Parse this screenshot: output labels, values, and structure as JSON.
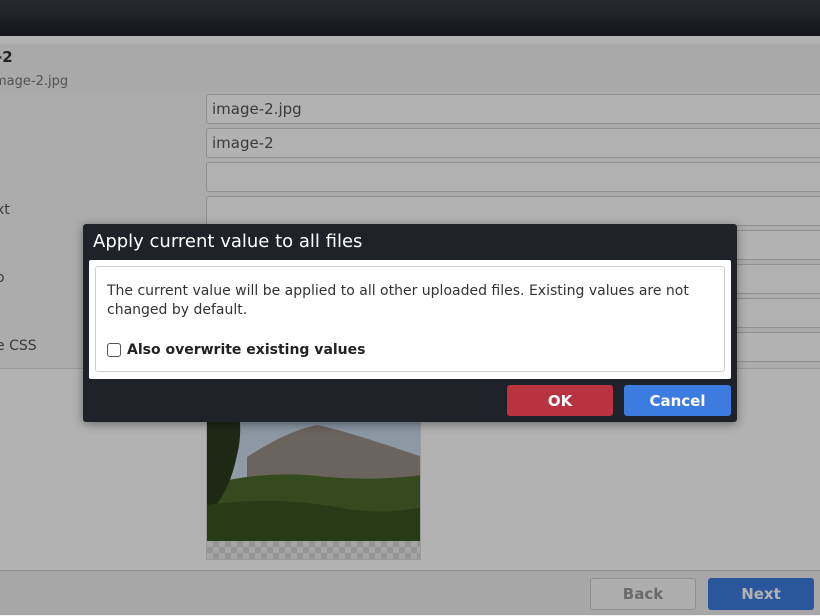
{
  "header": {
    "title": "-2",
    "subtitle": "mage-2.jpg"
  },
  "form": {
    "labels": [
      "xt",
      "o",
      "e CSS"
    ],
    "fields": [
      {
        "value": "image-2.jpg"
      },
      {
        "value": "image-2"
      },
      {
        "value": ""
      },
      {
        "value": ""
      },
      {
        "value": ""
      },
      {
        "value": ""
      },
      {
        "value": ""
      },
      {
        "value": ""
      }
    ]
  },
  "footer": {
    "back_label": "Back",
    "next_label": "Next"
  },
  "dialog": {
    "title": "Apply current value to all files",
    "message": "The current value will be applied to all other uploaded files. Existing values are not changed by default.",
    "checkbox_label": "Also overwrite existing values",
    "checkbox_checked": false,
    "ok_label": "OK",
    "cancel_label": "Cancel"
  },
  "colors": {
    "dialog_bg": "#1f2228",
    "ok": "#b83240",
    "cancel": "#3c7be0"
  }
}
